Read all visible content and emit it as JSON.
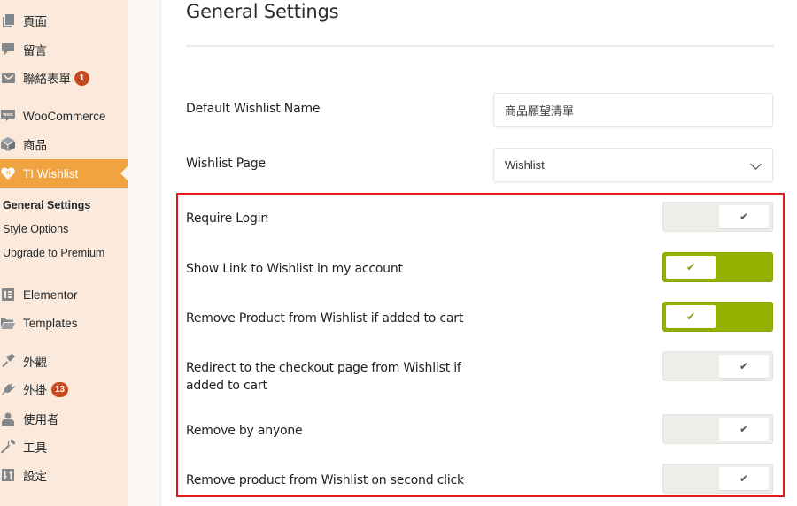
{
  "sidebar": {
    "items": [
      {
        "label": "頁面",
        "icon": "pages-icon"
      },
      {
        "label": "留言",
        "icon": "comments-icon"
      },
      {
        "label": "聯絡表單",
        "icon": "mail-icon",
        "badge": "1"
      },
      {
        "label": "WooCommerce",
        "icon": "woocommerce-icon"
      },
      {
        "label": "商品",
        "icon": "box-icon"
      },
      {
        "label": "TI Wishlist",
        "icon": "heart-icon",
        "active": true
      },
      {
        "label": "Elementor",
        "icon": "elementor-icon"
      },
      {
        "label": "Templates",
        "icon": "folder-icon"
      },
      {
        "label": "外觀",
        "icon": "paintbrush-icon"
      },
      {
        "label": "外掛",
        "icon": "plugin-icon",
        "badge": "13"
      },
      {
        "label": "使用者",
        "icon": "user-icon"
      },
      {
        "label": "工具",
        "icon": "wrench-icon"
      },
      {
        "label": "設定",
        "icon": "settings-icon"
      }
    ],
    "submenu": [
      {
        "label": "General Settings",
        "current": true
      },
      {
        "label": "Style Options"
      },
      {
        "label": "Upgrade to Premium"
      }
    ]
  },
  "main": {
    "title": "General Settings",
    "default_wishlist_name": {
      "label": "Default Wishlist Name",
      "value": "商品願望清單"
    },
    "wishlist_page": {
      "label": "Wishlist Page",
      "selected": "Wishlist"
    },
    "toggles": [
      {
        "label": "Require Login",
        "on": false
      },
      {
        "label": "Show Link to Wishlist in my account",
        "on": true
      },
      {
        "label": "Remove Product from Wishlist if added to cart",
        "on": true
      },
      {
        "label": "Redirect to the checkout page from Wishlist if added to cart",
        "on": false
      },
      {
        "label": "Remove by anyone",
        "on": false
      },
      {
        "label": "Remove product from Wishlist on second click",
        "on": false
      }
    ],
    "toggle_check_glyph": "✔"
  },
  "colors": {
    "sidebar_bg": "#fbeadb",
    "active_menu": "#f0a33f",
    "badge": "#ca4a1f",
    "toggle_on": "#96b100",
    "toggle_off": "#efedea",
    "highlight_border": "#e41b1b"
  }
}
